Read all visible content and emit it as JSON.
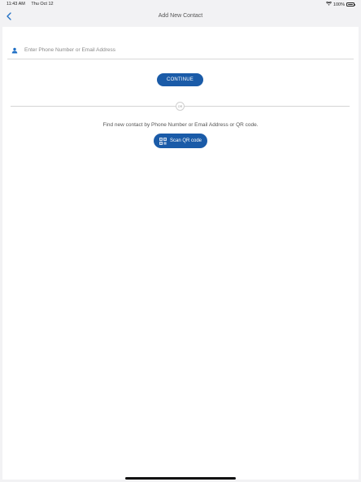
{
  "status_bar": {
    "time": "11:43 AM",
    "date": "Thu Oct 12",
    "battery": "100%",
    "battery_level": 1.0
  },
  "nav": {
    "title": "Add New Contact",
    "back_icon": "chevron-left-icon"
  },
  "form": {
    "input_placeholder": "Enter Phone Number or Email Address",
    "input_value": "",
    "input_icon": "person-icon",
    "continue_label": "CONTINUE"
  },
  "divider": {
    "label": "OR"
  },
  "helper": {
    "text": "Find new contact by Phone Number or Email Address or QR code."
  },
  "scan": {
    "label": "Scan QR code",
    "icon": "qr-code-icon"
  },
  "colors": {
    "accent": "#1a5ba8",
    "icon_blue": "#1f6fc5",
    "background": "#f2f2f4",
    "card": "#ffffff"
  }
}
